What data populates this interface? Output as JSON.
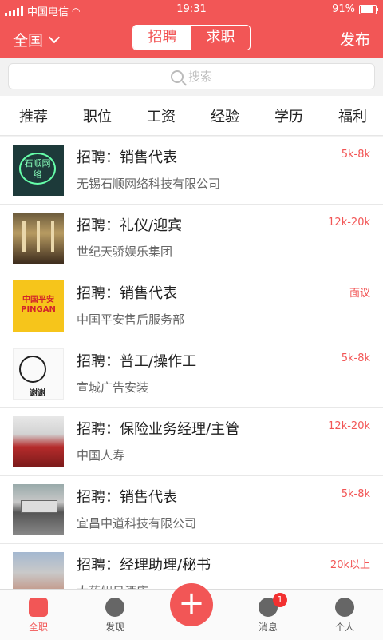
{
  "status_bar": {
    "carrier": "中国电信",
    "time": "19:31",
    "battery": "91%"
  },
  "header": {
    "region": "全国",
    "segments": [
      "招聘",
      "求职"
    ],
    "active_segment": "招聘",
    "publish": "发布"
  },
  "search": {
    "placeholder": "搜索"
  },
  "filters": [
    "推荐",
    "职位",
    "工资",
    "经验",
    "学历",
    "福利"
  ],
  "jobs": [
    {
      "title": "招聘：销售代表",
      "company": "无锡石顺网络科技有限公司",
      "salary": "5k-8k",
      "logo_text": "石顺网络"
    },
    {
      "title": "招聘：礼仪/迎宾",
      "company": "世纪天骄娱乐集团",
      "salary": "12k-20k"
    },
    {
      "title": "招聘：销售代表",
      "company": "中国平安售后服务部",
      "salary": "面议",
      "logo_text": "中国平安 PINGAN"
    },
    {
      "title": "招聘：普工/操作工",
      "company": "宣城广告安装",
      "salary": "5k-8k",
      "logo_text": "谢谢"
    },
    {
      "title": "招聘：保险业务经理/主管",
      "company": "中国人寿",
      "salary": "12k-20k"
    },
    {
      "title": "招聘：销售代表",
      "company": "宜昌中道科技有限公司",
      "salary": "5k-8k"
    },
    {
      "title": "招聘：经理助理/秘书",
      "company": "大药假日酒店",
      "salary": "20k以上"
    }
  ],
  "tabbar": {
    "items": [
      "全职",
      "发现",
      "消息",
      "个人"
    ],
    "active": "全职",
    "message_badge": "1"
  },
  "colors": {
    "accent": "#f25656"
  }
}
